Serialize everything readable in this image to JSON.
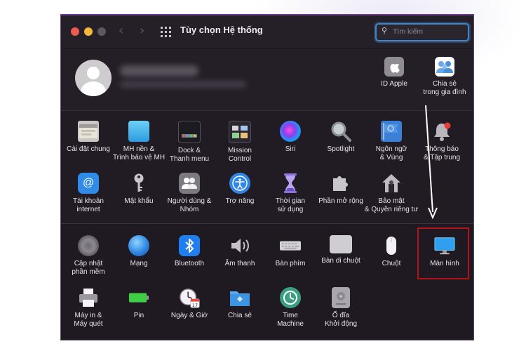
{
  "window": {
    "title": "Tùy chọn Hệ thống",
    "search_placeholder": "Tìm kiếm"
  },
  "account": {
    "apple_id": "ID Apple",
    "family_line1": "Chia sẻ",
    "family_line2": "trong gia đình"
  },
  "row1": [
    {
      "l1": "Cài đặt chung",
      "l2": ""
    },
    {
      "l1": "MH nền &",
      "l2": "Trình bảo vệ MH"
    },
    {
      "l1": "Dock &",
      "l2": "Thanh menu"
    },
    {
      "l1": "Mission",
      "l2": "Control"
    },
    {
      "l1": "Siri",
      "l2": ""
    },
    {
      "l1": "Spotlight",
      "l2": ""
    },
    {
      "l1": "Ngôn ngữ",
      "l2": "& Vùng"
    },
    {
      "l1": "Thông báo",
      "l2": "& Tập trung"
    }
  ],
  "row2": [
    {
      "l1": "Tài khoản",
      "l2": "internet"
    },
    {
      "l1": "Mật khẩu",
      "l2": ""
    },
    {
      "l1": "Người dùng &",
      "l2": "Nhóm"
    },
    {
      "l1": "Trợ năng",
      "l2": ""
    },
    {
      "l1": "Thời gian",
      "l2": "sử dụng"
    },
    {
      "l1": "Phần mở rộng",
      "l2": ""
    },
    {
      "l1": "Bảo mật",
      "l2": "& Quyền riêng tư"
    }
  ],
  "row3": [
    {
      "l1": "Cập nhật",
      "l2": "phần mềm"
    },
    {
      "l1": "Mạng",
      "l2": ""
    },
    {
      "l1": "Bluetooth",
      "l2": ""
    },
    {
      "l1": "Âm thanh",
      "l2": ""
    },
    {
      "l1": "Bàn phím",
      "l2": ""
    },
    {
      "l1": "Bàn di chuột",
      "l2": ""
    },
    {
      "l1": "Chuột",
      "l2": ""
    },
    {
      "l1": "Màn hình",
      "l2": ""
    }
  ],
  "row4": [
    {
      "l1": "Máy in &",
      "l2": "Máy quét"
    },
    {
      "l1": "Pin",
      "l2": ""
    },
    {
      "l1": "Ngày & Giờ",
      "l2": ""
    },
    {
      "l1": "Chia sẻ",
      "l2": ""
    },
    {
      "l1": "Time",
      "l2": "Machine"
    },
    {
      "l1": "Ổ đĩa",
      "l2": "Khởi động"
    }
  ],
  "calendar_day": "17",
  "colors": {
    "highlight_border": "#b3121b",
    "search_focus": "#3e86c9"
  }
}
